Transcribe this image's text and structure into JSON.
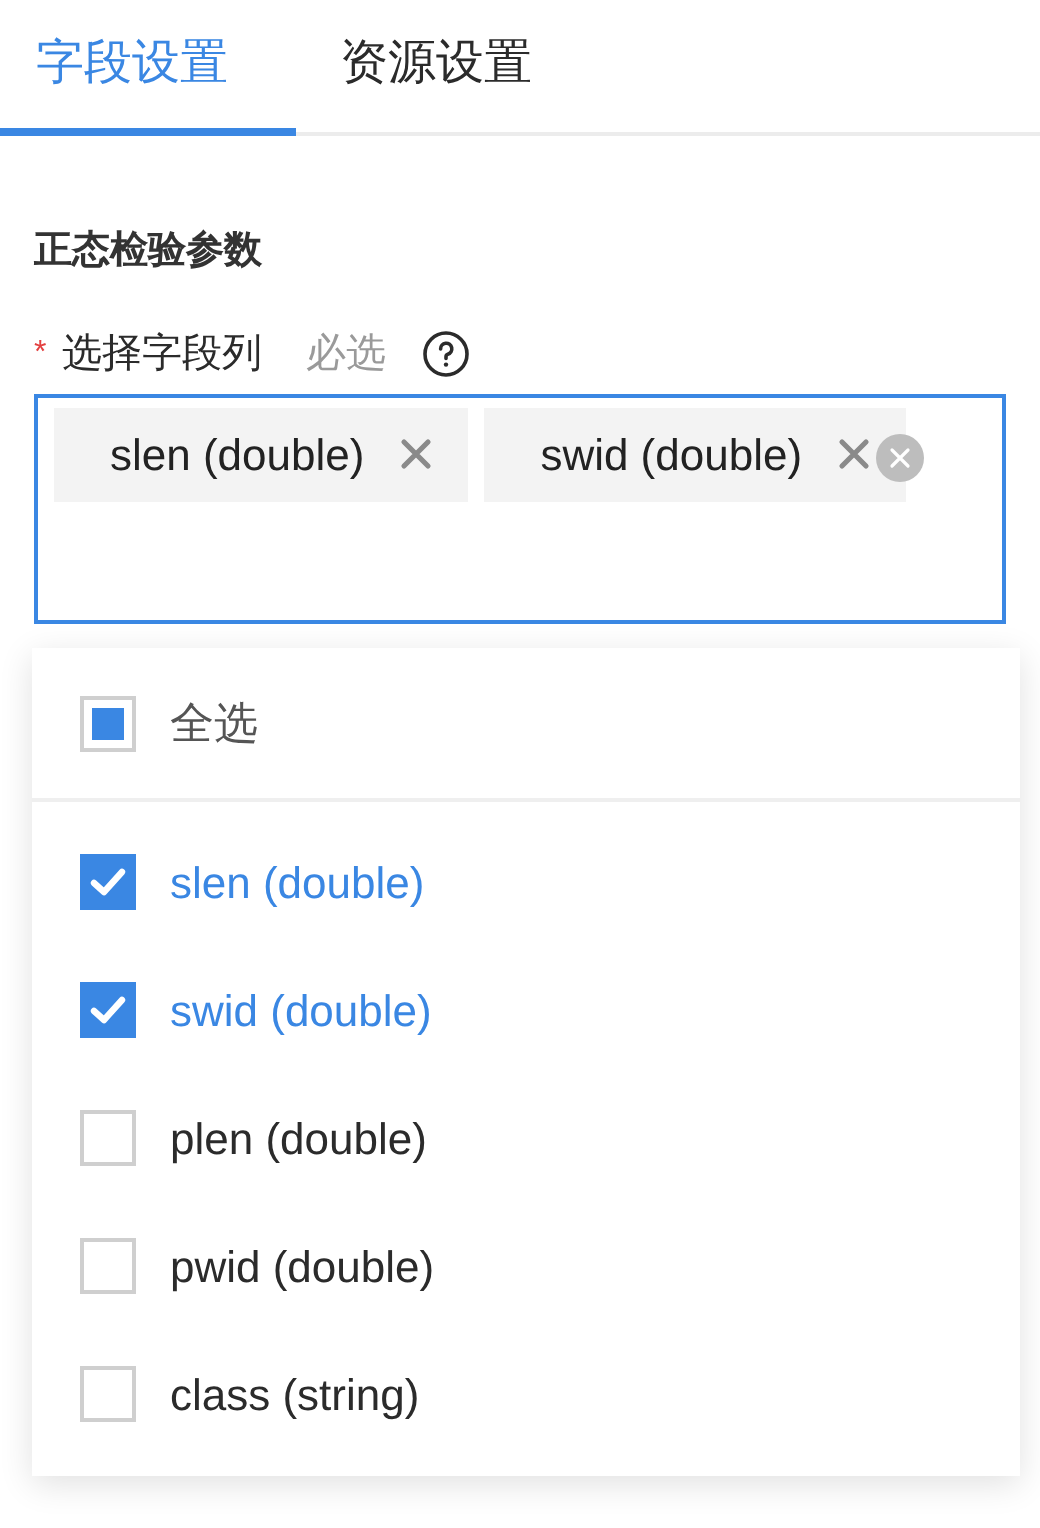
{
  "tabs": [
    {
      "label": "字段设置",
      "selected": true
    },
    {
      "label": "资源设置",
      "selected": false
    }
  ],
  "section_title": "正态检验参数",
  "field": {
    "label": "选择字段列",
    "required_mark": "*",
    "hint": "必选",
    "tags": [
      "slen (double)",
      "swid (double)"
    ]
  },
  "dropdown": {
    "select_all": {
      "label": "全选",
      "indeterminate": true
    },
    "options": [
      {
        "label": "slen (double)",
        "checked": true
      },
      {
        "label": "swid (double)",
        "checked": true
      },
      {
        "label": "plen (double)",
        "checked": false
      },
      {
        "label": "pwid (double)",
        "checked": false
      },
      {
        "label": "class (string)",
        "checked": false
      }
    ]
  }
}
